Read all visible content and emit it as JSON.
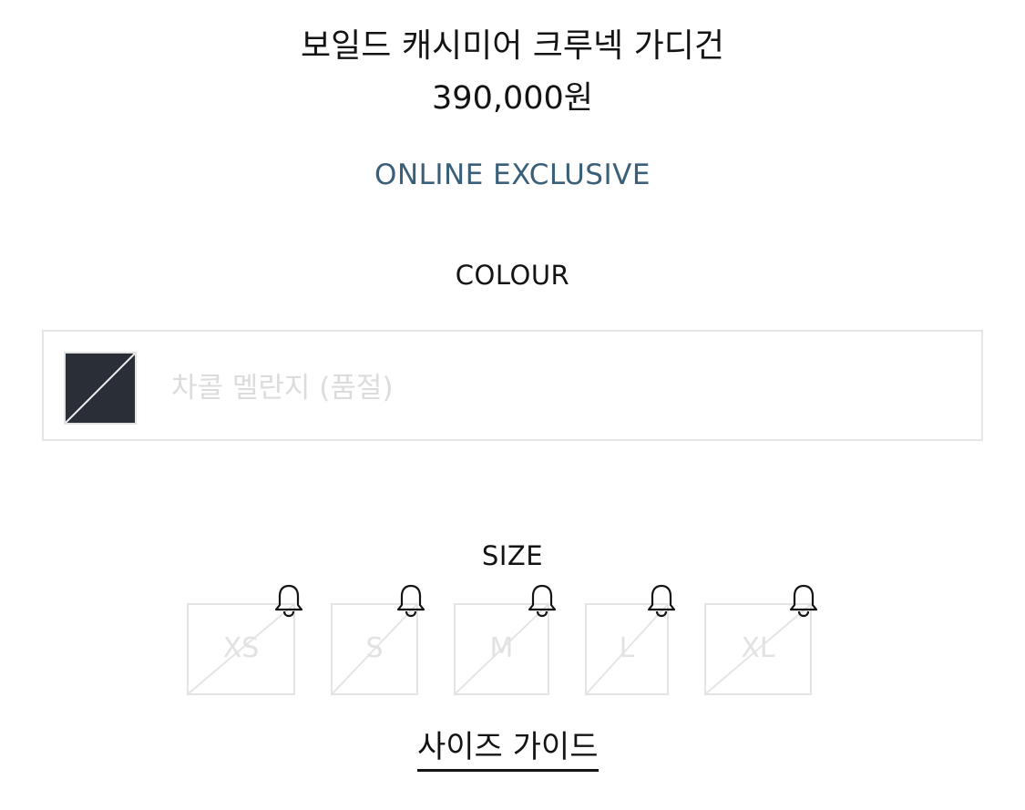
{
  "product": {
    "title": "보일드 캐시미어 크루넥 가디건",
    "price": "390,000원",
    "badge": "ONLINE EXCLUSIVE"
  },
  "colour": {
    "label": "COLOUR",
    "selected_name": "차콜 멜란지 (품절)",
    "swatch_color": "#2a2e37",
    "sold_out": true
  },
  "size": {
    "label": "SIZE",
    "options": [
      {
        "label": "XS",
        "sold_out": true,
        "icon": "bell-icon"
      },
      {
        "label": "S",
        "sold_out": true,
        "icon": "bell-icon"
      },
      {
        "label": "M",
        "sold_out": true,
        "icon": "bell-icon"
      },
      {
        "label": "L",
        "sold_out": true,
        "icon": "bell-icon"
      },
      {
        "label": "XL",
        "sold_out": true,
        "icon": "bell-icon"
      }
    ],
    "guide_link": "사이즈 가이드"
  },
  "colors": {
    "accent": "#3a5f78",
    "text": "#141414",
    "disabled": "#e2e2e2"
  }
}
